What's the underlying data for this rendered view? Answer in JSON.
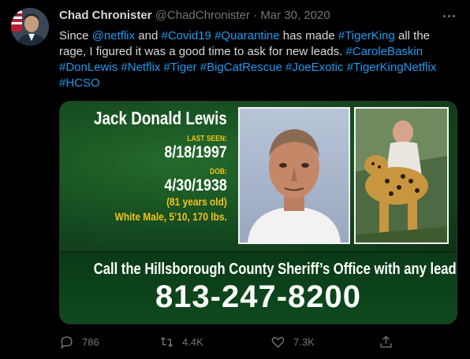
{
  "tweet": {
    "display_name": "Chad Chronister",
    "handle": "@ChadChronister",
    "separator": " · ",
    "date": "Mar 30, 2020",
    "text_parts": [
      {
        "t": "Since ",
        "link": false
      },
      {
        "t": "@netflix",
        "link": true
      },
      {
        "t": " and ",
        "link": false
      },
      {
        "t": "#Covid19",
        "link": true
      },
      {
        "t": " ",
        "link": false
      },
      {
        "t": "#Quarantine",
        "link": true
      },
      {
        "t": " has made ",
        "link": false
      },
      {
        "t": "#TigerKing",
        "link": true
      },
      {
        "t": " all the rage, I figured it was a good time to ask for new leads. ",
        "link": false
      },
      {
        "t": "#CaroleBaskin",
        "link": true
      },
      {
        "t": " ",
        "link": false
      },
      {
        "t": "#DonLewis",
        "link": true
      },
      {
        "t": " ",
        "link": false
      },
      {
        "t": "#Netflix",
        "link": true
      },
      {
        "t": " ",
        "link": false
      },
      {
        "t": "#Tiger",
        "link": true
      },
      {
        "t": " ",
        "link": false
      },
      {
        "t": "#BigCatRescue",
        "link": true
      },
      {
        "t": " ",
        "link": false
      },
      {
        "t": "#JoeExotic",
        "link": true
      },
      {
        "t": " ",
        "link": false
      },
      {
        "t": "#TigerKingNetflix",
        "link": true
      },
      {
        "t": " ",
        "link": false
      },
      {
        "t": "#HCSO",
        "link": true
      }
    ]
  },
  "card": {
    "name": "Jack Donald Lewis",
    "last_seen_label": "LAST SEEN:",
    "last_seen": "8/18/1997",
    "dob_label": "DOB:",
    "dob": "4/30/1938",
    "age": "(81 years old)",
    "description": "White Male, 5’10, 170 lbs.",
    "call_text": "Call the Hillsborough County Sheriff’s Office with any leads at",
    "phone": "813-247-8200"
  },
  "actions": {
    "replies": "786",
    "retweets": "4.4K",
    "likes": "7.3K"
  },
  "colors": {
    "link": "#1d9bf0",
    "muted": "#6e767d",
    "card_green": "#154a20",
    "label_yellow": "#f2c21b"
  },
  "icons": [
    "more-icon",
    "reply-icon",
    "retweet-icon",
    "like-icon",
    "share-icon"
  ]
}
